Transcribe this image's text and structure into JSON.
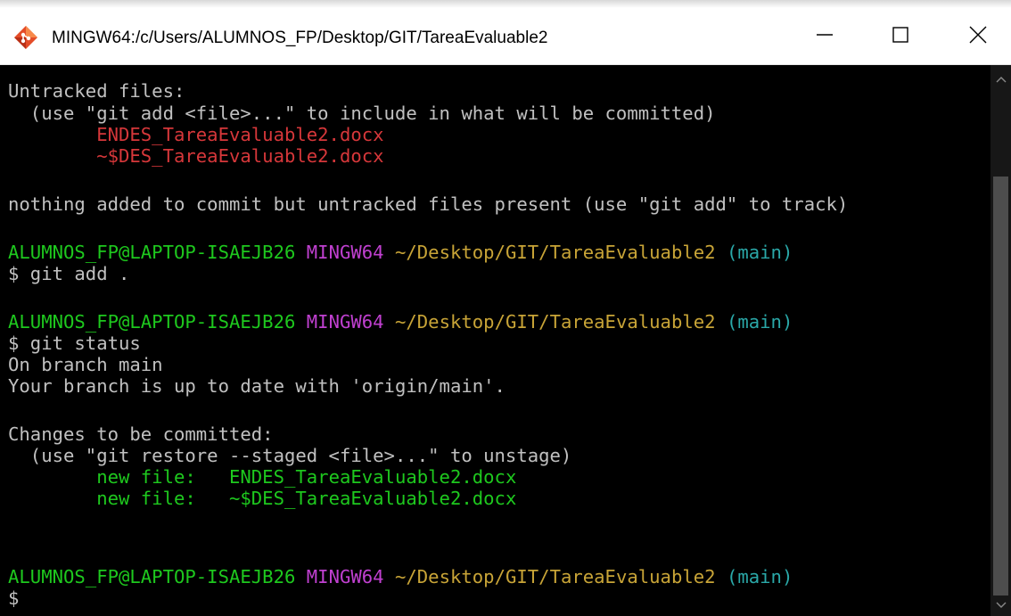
{
  "window": {
    "title": "MINGW64:/c/Users/ALUMNOS_FP/Desktop/GIT/TareaEvaluable2",
    "icon": "git-bash-icon",
    "controls": [
      "minimize-icon",
      "maximize-icon",
      "close-icon"
    ]
  },
  "colors": {
    "background": "#000000",
    "default_text": "#c0c0c0",
    "red": "#d6373a",
    "green": "#1ec81e",
    "magenta": "#c040d0",
    "yellow": "#c8a437",
    "cyan": "#2aa8a8"
  },
  "terminal": {
    "untracked_header": "Untracked files:",
    "untracked_hint": "  (use \"git add <file>...\" to include in what will be committed)",
    "untracked_files": [
      "        ENDES_TareaEvaluable2.docx",
      "        ~$DES_TareaEvaluable2.docx"
    ],
    "nothing_added": "nothing added to commit but untracked files present (use \"git add\" to track)",
    "prompt": {
      "user_host": "ALUMNOS_FP@LAPTOP-ISAEJB26",
      "shell": "MINGW64",
      "path": "~/Desktop/GIT/TareaEvaluable2",
      "branch": "(main)"
    },
    "cmd_add": "$ git add .",
    "cmd_status": "$ git status",
    "on_branch": "On branch main",
    "up_to_date": "Your branch is up to date with 'origin/main'.",
    "changes_header": "Changes to be committed:",
    "changes_hint": "  (use \"git restore --staged <file>...\" to unstage)",
    "staged": [
      {
        "label": "        new file:",
        "file": "   ENDES_TareaEvaluable2.docx"
      },
      {
        "label": "        new file:",
        "file": "   ~$DES_TareaEvaluable2.docx"
      }
    ],
    "final_prompt_char": "$"
  }
}
